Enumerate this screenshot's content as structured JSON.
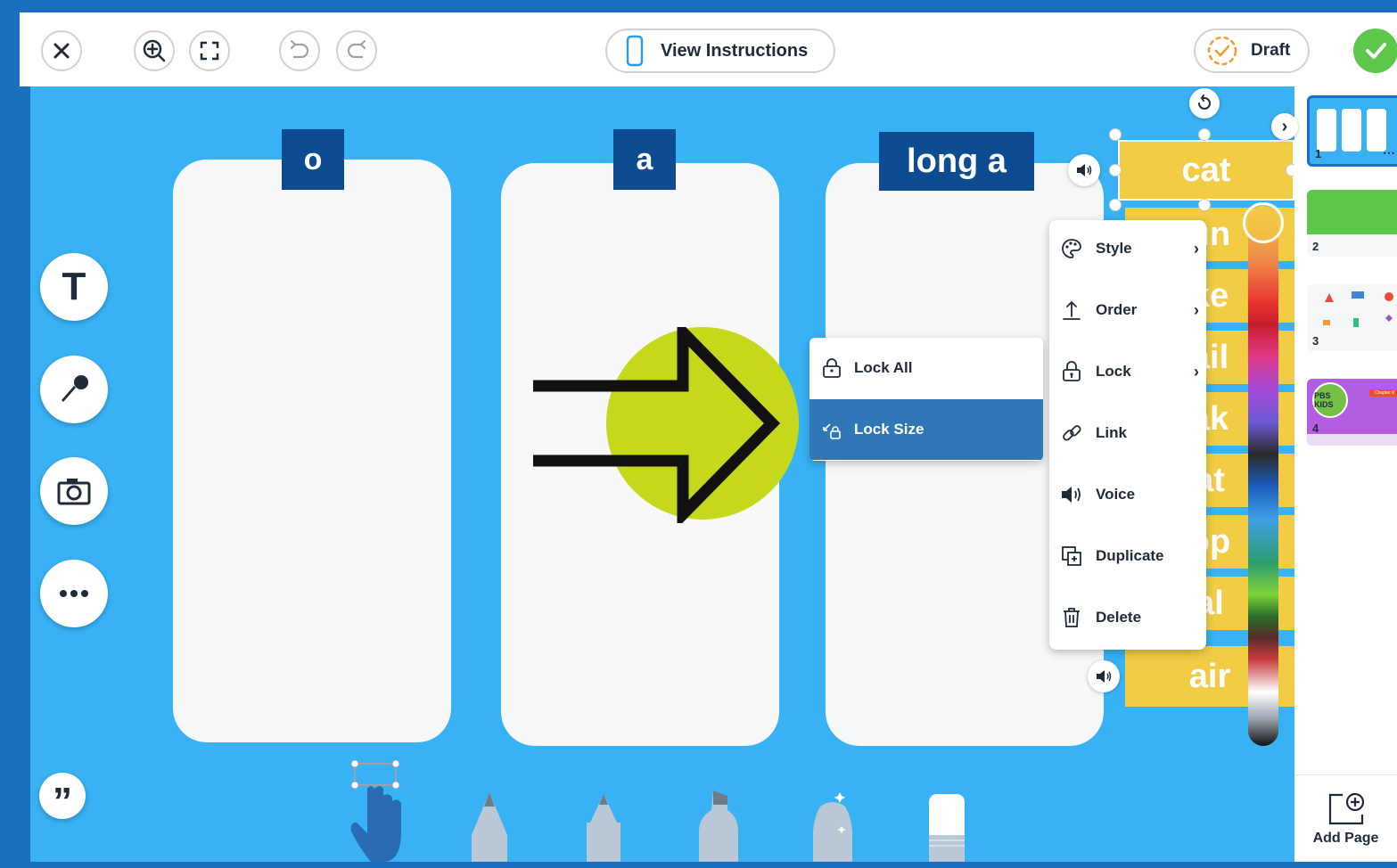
{
  "toolbar": {
    "instructions_label": "View Instructions",
    "draft_label": "Draft"
  },
  "columns": [
    {
      "heading": "o"
    },
    {
      "heading": "a"
    },
    {
      "heading": "long a"
    }
  ],
  "word_cards": [
    "cat",
    "un",
    "ke",
    "ail",
    "ak",
    "at",
    "op",
    "al",
    "air"
  ],
  "context_menu": {
    "items": [
      {
        "label": "Style",
        "icon": "palette-icon",
        "has_submenu": true
      },
      {
        "label": "Order",
        "icon": "arrow-up-icon",
        "has_submenu": true
      },
      {
        "label": "Lock",
        "icon": "padlock-icon",
        "has_submenu": true
      },
      {
        "label": "Link",
        "icon": "link-icon",
        "has_submenu": false
      },
      {
        "label": "Voice",
        "icon": "speaker-icon",
        "has_submenu": false
      },
      {
        "label": "Duplicate",
        "icon": "duplicate-icon",
        "has_submenu": false
      },
      {
        "label": "Delete",
        "icon": "trash-icon",
        "has_submenu": false
      }
    ]
  },
  "lock_submenu": {
    "items": [
      {
        "label": "Lock All",
        "icon": "padlock-icon",
        "selected": false
      },
      {
        "label": "Lock Size",
        "icon": "lock-size-icon",
        "selected": true
      }
    ]
  },
  "pages": [
    {
      "number": "1",
      "selected": true
    },
    {
      "number": "2",
      "selected": false
    },
    {
      "number": "3",
      "selected": false
    },
    {
      "number": "4",
      "selected": false
    }
  ],
  "thumbnail_texts": {
    "page4_logo": "PBS KIDS",
    "page4_tag": "Chapter 8"
  },
  "sidebar": {
    "add_page_label": "Add Page"
  },
  "colors": {
    "canvas_bg": "#38b2f5",
    "frame": "#1b6fbf",
    "heading_bg": "#0e4c92",
    "card_bg": "#f2cc45",
    "selected_menu_bg": "#2f77b6",
    "submit_green": "#5cc74a",
    "pointer_arrow_circle": "#c6d81b"
  }
}
